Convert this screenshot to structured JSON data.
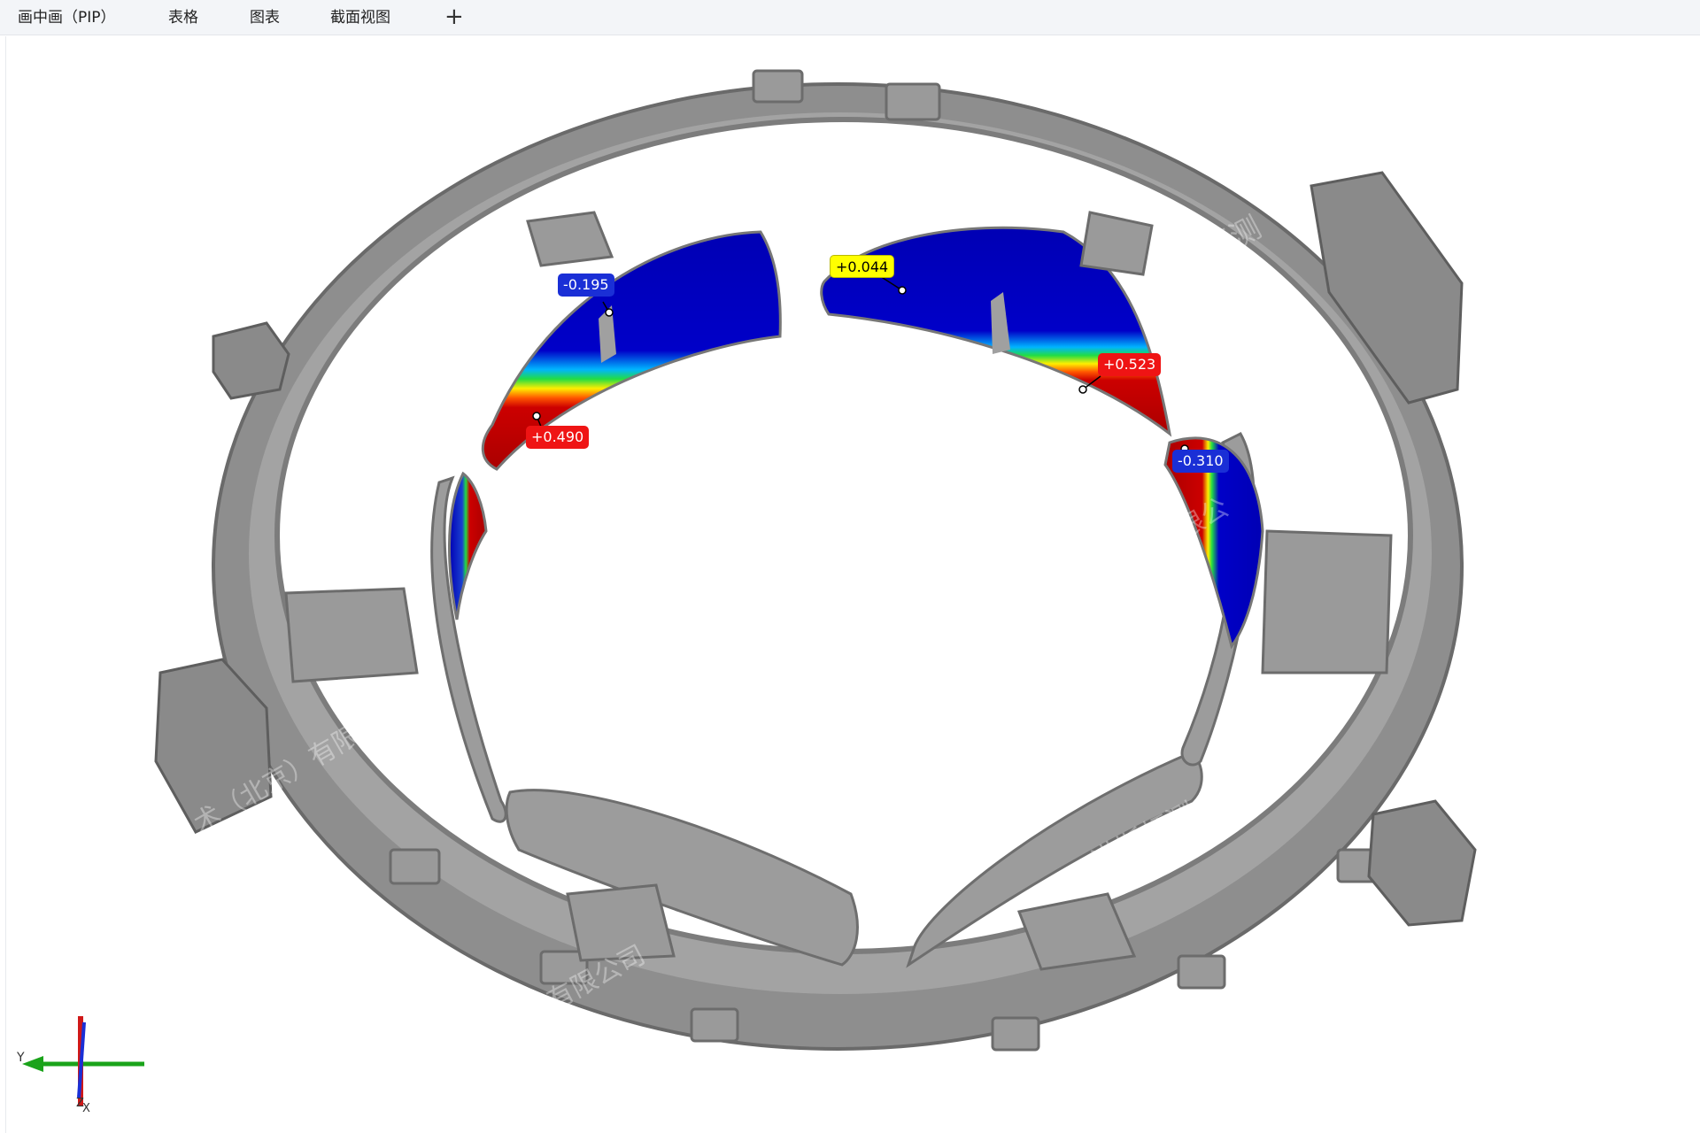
{
  "tabs": [
    {
      "label": "画中画（PIP）"
    },
    {
      "label": "表格"
    },
    {
      "label": "图表"
    },
    {
      "label": "截面视图"
    }
  ],
  "add_tab_label": "+",
  "callouts": [
    {
      "label": "-0.195",
      "status": "negative",
      "color": "#1a2fd6"
    },
    {
      "label": "+0.490",
      "status": "positive",
      "color": "#ef1414"
    },
    {
      "label": "+0.044",
      "status": "near-nominal",
      "color": "#ffff00"
    },
    {
      "label": "+0.523",
      "status": "positive",
      "color": "#ef1414"
    },
    {
      "label": "-0.310",
      "status": "negative",
      "color": "#1a2fd6"
    }
  ],
  "watermarks": [
    "诺斯顿测",
    "术（北京）有限公司",
    "诺斯顿测",
    "北京）有限公司",
    "限公"
  ],
  "axis_triad": {
    "y_label": "Y",
    "x_label": "X",
    "z_label": "Z"
  },
  "colors": {
    "part": "#8e8e8e",
    "deviation_high": "#cc0000",
    "deviation_low": "#0000b4",
    "axis_y": "#1aa31a",
    "axis_z": "#1a2fd6",
    "axis_x": "#d01818"
  }
}
